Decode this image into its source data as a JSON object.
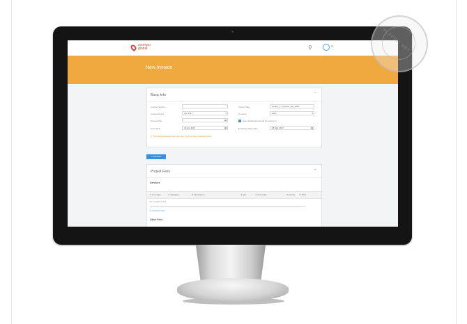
{
  "watermark": {
    "text": "PLACEIT.NET"
  },
  "header": {
    "logo_line1": "zoompu",
    "logo_line2": "global",
    "pin_icon": "pin-icon",
    "avatar_icon": "user-avatar-icon"
  },
  "banner": {
    "title": "New Invoice",
    "color": "#f0a93e"
  },
  "basic_info": {
    "title": "Basic Info",
    "left_fields": [
      {
        "label": "Invoice Number",
        "value": ""
      },
      {
        "label": "Invoice Period",
        "value": "Apr 2017"
      },
      {
        "label": "Payment By",
        "value": ""
      },
      {
        "label": "Issue Date",
        "value": "30 Apr 2017"
      }
    ],
    "right_fields": [
      {
        "label": "Invoice Title",
        "value": "project_77_invoice_Apr_2017"
      },
      {
        "label": "Currency",
        "value": "SGD"
      },
      {
        "label": "checkbox",
        "value": "Send Notification Email To Customer"
      },
      {
        "label": "Exchange Rate Date",
        "value": "18 Mar 2017"
      }
    ],
    "warning": "The final exchange rate may vary from the rates indicated here."
  },
  "add_row_button": {
    "label": "+ Add Row"
  },
  "project_fees": {
    "title": "Project Fees",
    "services_label": "Services",
    "columns": [
      "Fee Type",
      "Category",
      "Description",
      "Qty",
      "Item price",
      "Currency",
      "Total"
    ],
    "empty_text": "No records found",
    "add_item": "Add New Item",
    "other_fees_label": "Other Fees"
  },
  "colors": {
    "accent": "#3a8ee0",
    "brand": "#d64a3a",
    "warning": "#e5962b"
  }
}
